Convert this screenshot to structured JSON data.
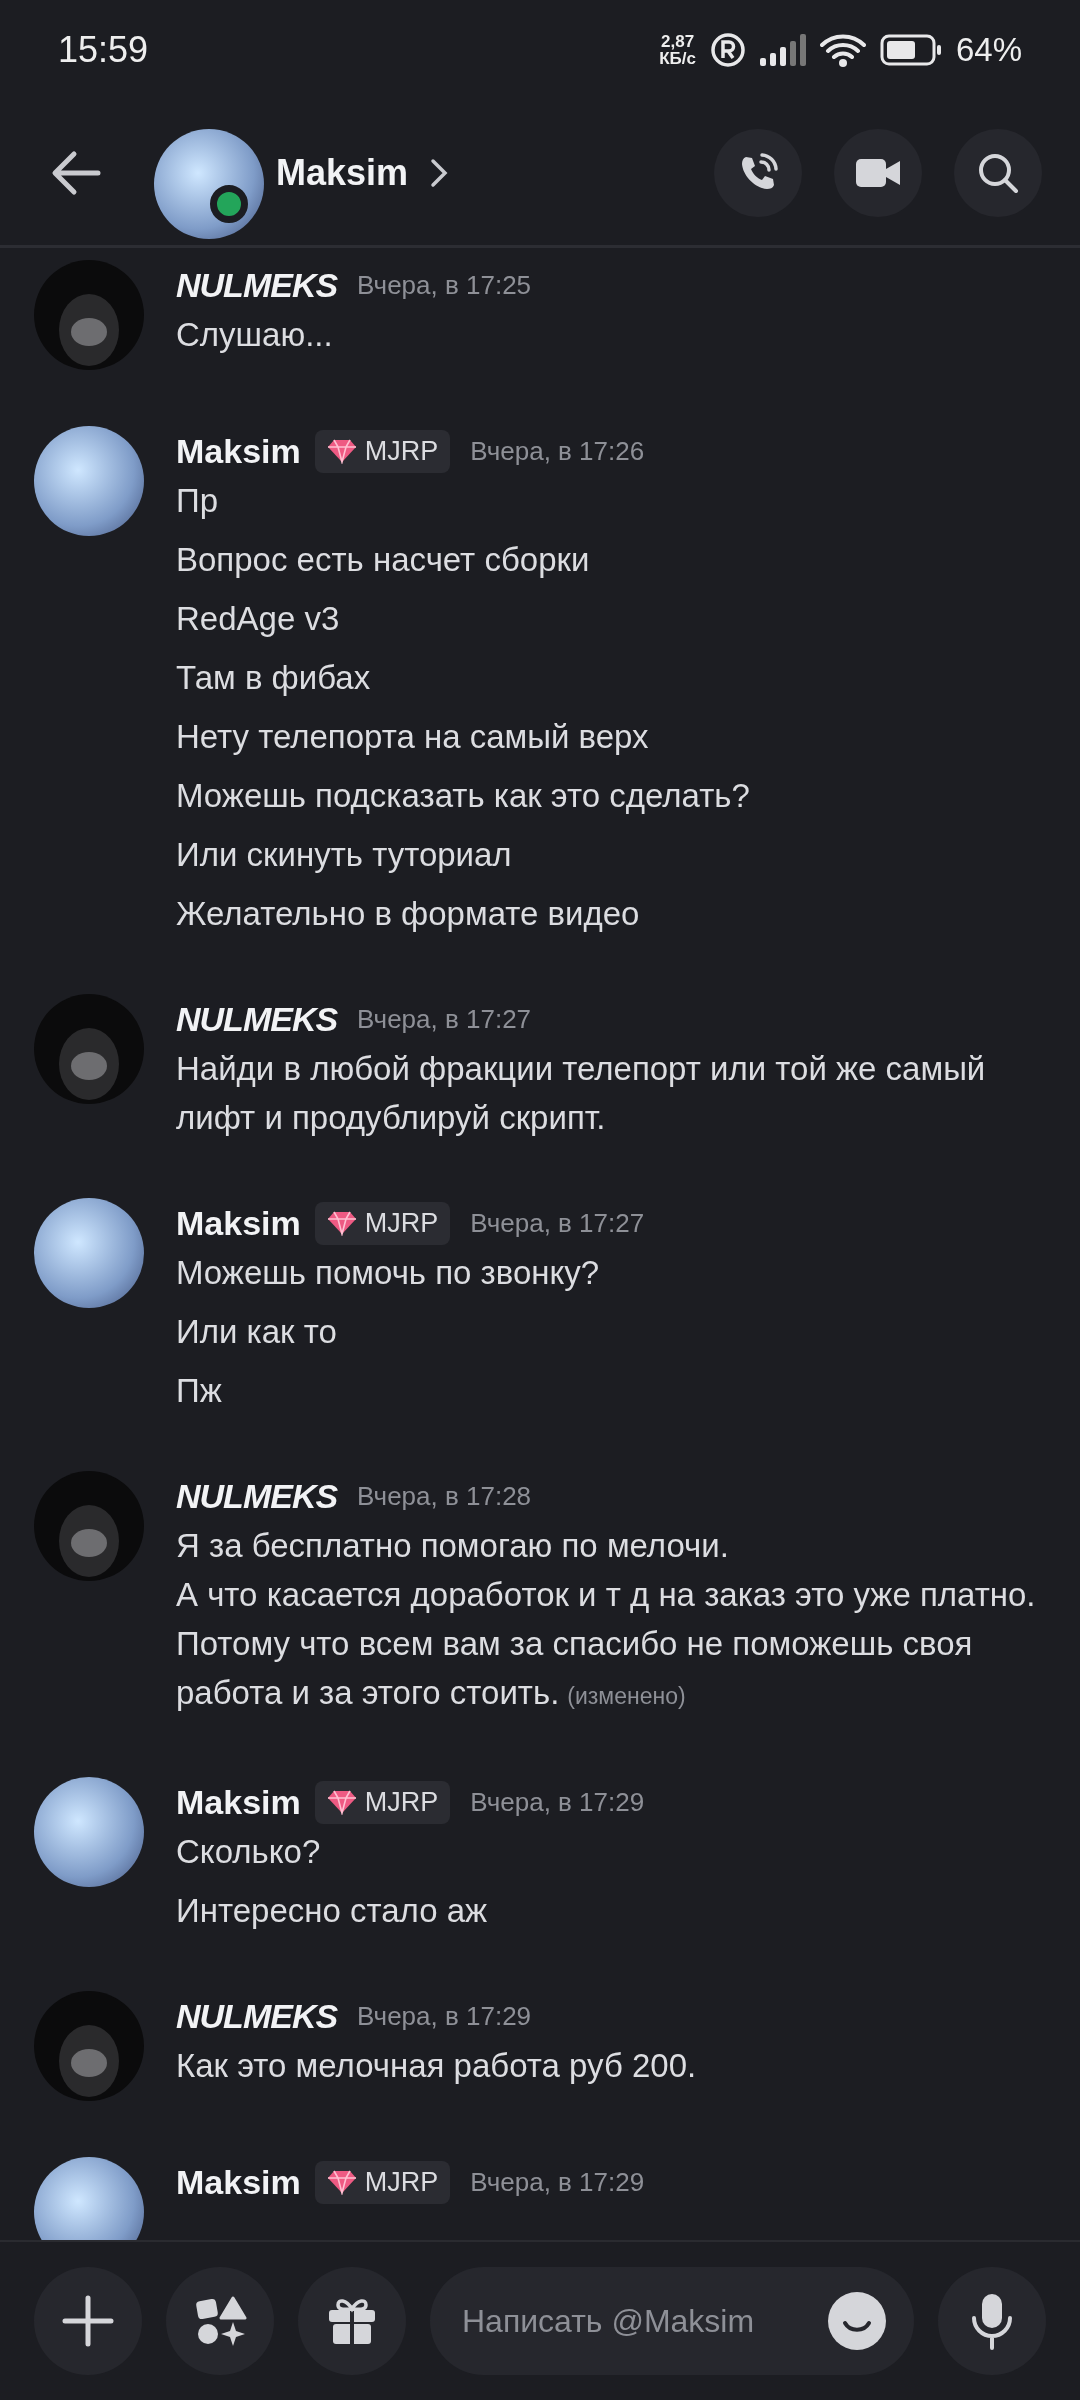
{
  "status_bar": {
    "time": "15:59",
    "speed_value": "2,87",
    "speed_unit": "КБ/с",
    "battery": "64%"
  },
  "header": {
    "name": "Maksim",
    "online": true
  },
  "messages": [
    {
      "kind": "other",
      "author": "NULMEKS",
      "time": "Вчера, в 17:25",
      "lines": [
        {
          "text": "Слушаю..."
        }
      ]
    },
    {
      "kind": "contact",
      "author": "Maksim",
      "badge": "MJRP",
      "time": "Вчера, в 17:26",
      "lines": [
        {
          "text": "Пр"
        },
        {
          "text": "Вопрос есть насчет сборки"
        },
        {
          "text": "RedAge v3"
        },
        {
          "text": "Там в фибах"
        },
        {
          "text": "Нету телепорта на самый верх"
        },
        {
          "text": "Можешь подсказать как это сделать?"
        },
        {
          "text": "Или скинуть туториал"
        },
        {
          "text": "Желательно в формате видео"
        }
      ]
    },
    {
      "kind": "other",
      "author": "NULMEKS",
      "time": "Вчера, в 17:27",
      "lines": [
        {
          "text": "Найди в любой фракции телепорт или той же самый лифт и продублируй скрипт."
        }
      ]
    },
    {
      "kind": "contact",
      "author": "Maksim",
      "badge": "MJRP",
      "time": "Вчера, в 17:27",
      "lines": [
        {
          "text": "Можешь помочь по звонку?"
        },
        {
          "text": "Или как то"
        },
        {
          "text": "Пж"
        }
      ]
    },
    {
      "kind": "other",
      "author": "NULMEKS",
      "time": "Вчера, в 17:28",
      "lines": [
        {
          "text": "Я за бесплатно помогаю по мелочи.\nА что касается доработок и т д на заказ это уже платно.\nПотому что всем вам за спасибо не поможешь своя работа и за этого стоить.",
          "edited_label": "(изменено)"
        }
      ]
    },
    {
      "kind": "contact",
      "author": "Maksim",
      "badge": "MJRP",
      "time": "Вчера, в 17:29",
      "lines": [
        {
          "text": "Сколько?"
        },
        {
          "text": "Интересно стало аж"
        }
      ]
    },
    {
      "kind": "other",
      "author": "NULMEKS",
      "time": "Вчера, в 17:29",
      "lines": [
        {
          "text": "Как это мелочная работа руб 200."
        }
      ]
    },
    {
      "kind": "contact",
      "author": "Maksim",
      "badge": "MJRP",
      "time": "Вчера, в 17:29"
    }
  ],
  "composer": {
    "placeholder": "Написать @Maksim"
  }
}
